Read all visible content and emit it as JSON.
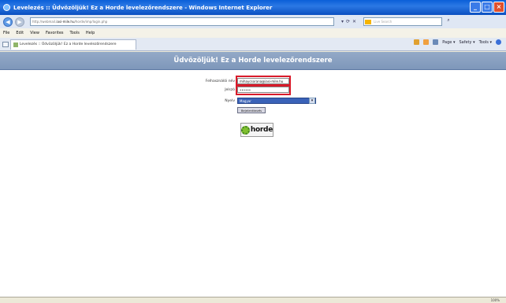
{
  "window": {
    "title": "Levelezés :: Üdvözöljük! Ez a Horde levelezőrendszere - Windows Internet Explorer",
    "controls": {
      "minimize": "_",
      "maximize": "□",
      "close": "×"
    }
  },
  "address_bar": {
    "url_prefix": "http://webmail.",
    "url_host": "iasi-mile.hu",
    "url_path": "/horde/imp/login.php",
    "search_placeholder": "Live Search"
  },
  "menu": {
    "items": [
      "File",
      "Edit",
      "View",
      "Favorites",
      "Tools",
      "Help"
    ]
  },
  "tab": {
    "label": "Levelezés :: Üdvözöljük! Ez a Horde levelezőrendszere"
  },
  "command_bar": {
    "page": "Page ▾",
    "safety": "Safety ▾",
    "tools": "Tools ▾",
    "help": "?"
  },
  "page": {
    "banner": "Üdvözöljük! Ez a Horde levelezőrendszere",
    "username_label": "Felhasználói név",
    "username_value": "mihaycsorana@iasi-mile.hu",
    "password_label": "Jelszó",
    "password_value": "••••••",
    "language_label": "Nyelv",
    "language_value": "Magyar",
    "login_button": "Bejelentkezés",
    "logo_text": "horde"
  },
  "status_bar": {
    "zoom": "100%"
  },
  "colors": {
    "banner": "#8aa0c0",
    "highlight": "#d91a2a",
    "titlebar": "#0a5fd8"
  }
}
